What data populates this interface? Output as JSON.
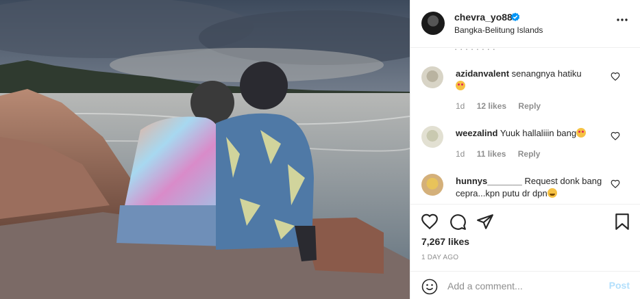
{
  "header": {
    "username": "chevra_yo88",
    "verified": true,
    "location": "Bangka-Belitung Islands",
    "more_icon": "more-horizontal-icon"
  },
  "comments": [
    {
      "username": "azidanvalent",
      "text": "senangnya hatiku",
      "emoji": "star-struck-emoji",
      "time": "1d",
      "likes": "12 likes",
      "reply": "Reply"
    },
    {
      "username": "weezalind",
      "text": "Yuuk hallaliiin bang",
      "emoji": "star-struck-emoji",
      "time": "1d",
      "likes": "11 likes",
      "reply": "Reply"
    },
    {
      "username": "hunnys_______",
      "text": "Request donk bang cepra...kpn putu dr dpn",
      "emoji": "grinning-emoji"
    }
  ],
  "actions": {
    "icons": [
      "heart-icon",
      "comment-icon",
      "share-icon",
      "bookmark-icon"
    ],
    "likes": "7,267 likes",
    "time_ago": "1 DAY AGO"
  },
  "add_comment": {
    "placeholder": "Add a comment...",
    "post_label": "Post",
    "emoji_icon": "smiley-icon"
  },
  "colors": {
    "text": "#262626",
    "muted": "#8e8e8e",
    "verified": "#0095f6",
    "post_disabled": "#b2dffc",
    "border": "#efefef"
  }
}
